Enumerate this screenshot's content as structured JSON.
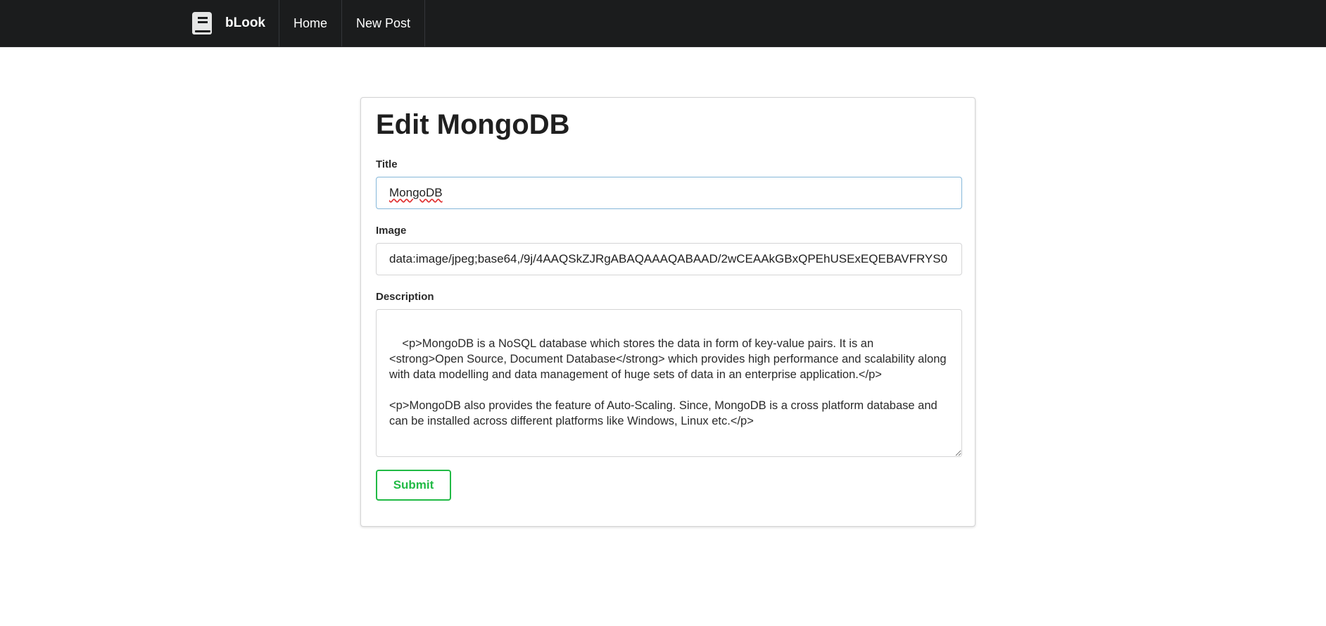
{
  "navbar": {
    "brand": "bLook",
    "brand_icon": "book-icon",
    "items": [
      {
        "label": "Home"
      },
      {
        "label": "New Post"
      }
    ],
    "background": "#1b1c1d"
  },
  "form": {
    "heading": "Edit MongoDB",
    "title_label": "Title",
    "title_value": "MongoDB",
    "image_label": "Image",
    "image_value": "data:image/jpeg;base64,/9j/4AAQSkZJRgABAQAAAQABAAD/2wCEAAkGBxQPEhUSExEQEBAVFRYS0",
    "description_label": "Description",
    "description_value": "<p>MongoDB is a NoSQL database which stores the data in form of key-value pairs. It is an <strong>Open Source, Document Database</strong> which provides high performance and scalability along with data modelling and data management of huge sets of data in an enterprise application.</p>\n\n<p>MongoDB also provides the feature of Auto-Scaling. Since, MongoDB is a cross platform database and can be installed across different platforms like Windows, Linux etc.</p>",
    "submit_label": "Submit",
    "submit_color": "#21ba45",
    "focus_border_color": "#85b7d9"
  }
}
